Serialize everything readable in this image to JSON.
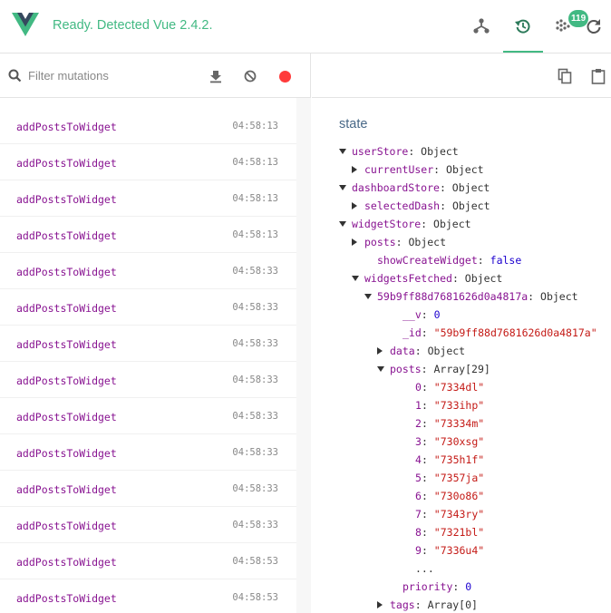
{
  "header": {
    "status": "Ready. Detected Vue 2.4.2.",
    "badge_count": "119",
    "accent": "#42b983"
  },
  "filter": {
    "placeholder": "Filter mutations"
  },
  "mutations": [
    {
      "name": "addPostsToWidget",
      "time": "04:58:13"
    },
    {
      "name": "addPostsToWidget",
      "time": "04:58:13"
    },
    {
      "name": "addPostsToWidget",
      "time": "04:58:13"
    },
    {
      "name": "addPostsToWidget",
      "time": "04:58:13"
    },
    {
      "name": "addPostsToWidget",
      "time": "04:58:33"
    },
    {
      "name": "addPostsToWidget",
      "time": "04:58:33"
    },
    {
      "name": "addPostsToWidget",
      "time": "04:58:33"
    },
    {
      "name": "addPostsToWidget",
      "time": "04:58:33"
    },
    {
      "name": "addPostsToWidget",
      "time": "04:58:33"
    },
    {
      "name": "addPostsToWidget",
      "time": "04:58:33"
    },
    {
      "name": "addPostsToWidget",
      "time": "04:58:33"
    },
    {
      "name": "addPostsToWidget",
      "time": "04:58:33"
    },
    {
      "name": "addPostsToWidget",
      "time": "04:58:53"
    },
    {
      "name": "addPostsToWidget",
      "time": "04:58:53"
    }
  ],
  "state_title": "state",
  "tree": [
    {
      "key": "userStore",
      "sep": ": ",
      "value": "Object",
      "vtype": "obj",
      "arrow": "down"
    },
    {
      "key": "currentUser",
      "sep": ": ",
      "value": "Object",
      "vtype": "obj",
      "arrow": "right"
    },
    {
      "key": "dashboardStore",
      "sep": ": ",
      "value": "Object",
      "vtype": "obj",
      "arrow": "down"
    },
    {
      "key": "selectedDash",
      "sep": ": ",
      "value": "Object",
      "vtype": "obj",
      "arrow": "right"
    },
    {
      "key": "widgetStore",
      "sep": ": ",
      "value": "Object",
      "vtype": "obj",
      "arrow": "down"
    },
    {
      "key": "posts",
      "sep": ": ",
      "value": "Object",
      "vtype": "obj",
      "arrow": "right"
    },
    {
      "key": "showCreateWidget",
      "sep": ": ",
      "value": "false",
      "vtype": "bool",
      "arrow": "none"
    },
    {
      "key": "widgetsFetched",
      "sep": ": ",
      "value": "Object",
      "vtype": "obj",
      "arrow": "down"
    },
    {
      "key": "59b9ff88d7681626d0a4817a",
      "sep": ": ",
      "value": "Object",
      "vtype": "obj",
      "arrow": "down"
    },
    {
      "key": "__v",
      "sep": ": ",
      "value": "0",
      "vtype": "num",
      "arrow": "none"
    },
    {
      "key": "_id",
      "sep": ": ",
      "value": "\"59b9ff88d7681626d0a4817a\"",
      "vtype": "str",
      "arrow": "none"
    },
    {
      "key": "data",
      "sep": ": ",
      "value": "Object",
      "vtype": "obj",
      "arrow": "right"
    },
    {
      "key": "posts",
      "sep": ": ",
      "value": "Array[29]",
      "vtype": "obj",
      "arrow": "down"
    },
    {
      "key": "0",
      "sep": ": ",
      "value": "\"7334dl\"",
      "vtype": "str",
      "arrow": "none"
    },
    {
      "key": "1",
      "sep": ": ",
      "value": "\"733ihp\"",
      "vtype": "str",
      "arrow": "none"
    },
    {
      "key": "2",
      "sep": ": ",
      "value": "\"73334m\"",
      "vtype": "str",
      "arrow": "none"
    },
    {
      "key": "3",
      "sep": ": ",
      "value": "\"730xsg\"",
      "vtype": "str",
      "arrow": "none"
    },
    {
      "key": "4",
      "sep": ": ",
      "value": "\"735h1f\"",
      "vtype": "str",
      "arrow": "none"
    },
    {
      "key": "5",
      "sep": ": ",
      "value": "\"7357ja\"",
      "vtype": "str",
      "arrow": "none"
    },
    {
      "key": "6",
      "sep": ": ",
      "value": "\"730o86\"",
      "vtype": "str",
      "arrow": "none"
    },
    {
      "key": "7",
      "sep": ": ",
      "value": "\"7343ry\"",
      "vtype": "str",
      "arrow": "none"
    },
    {
      "key": "8",
      "sep": ": ",
      "value": "\"7321bl\"",
      "vtype": "str",
      "arrow": "none"
    },
    {
      "key": "9",
      "sep": ": ",
      "value": "\"7336u4\"",
      "vtype": "str",
      "arrow": "none"
    },
    {
      "key": "...",
      "sep": "",
      "value": "",
      "vtype": "obj",
      "arrow": "none"
    },
    {
      "key": "priority",
      "sep": ": ",
      "value": "0",
      "vtype": "num",
      "arrow": "none"
    },
    {
      "key": "tags",
      "sep": ": ",
      "value": "Array[0]",
      "vtype": "obj",
      "arrow": "right"
    }
  ]
}
